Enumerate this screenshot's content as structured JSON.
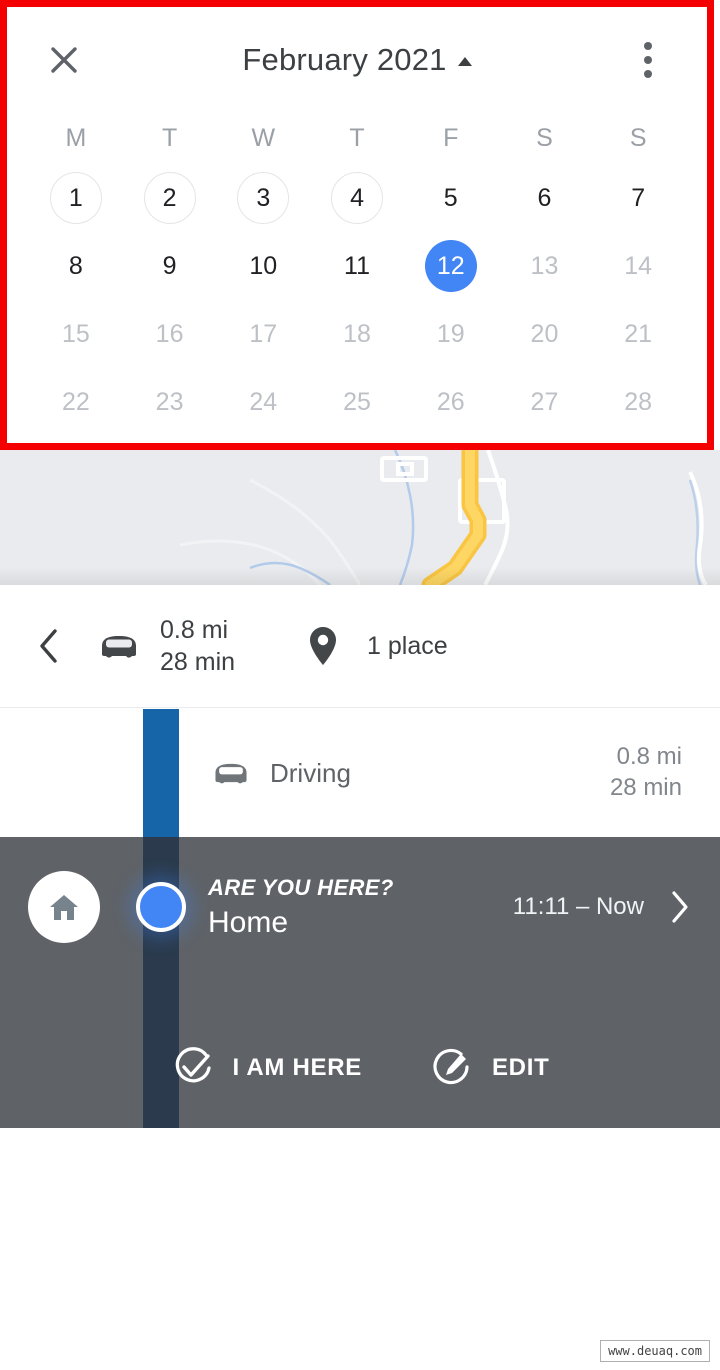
{
  "calendar": {
    "close_icon": "close-icon",
    "title": "February 2021",
    "expand_icon": "caret-up-icon",
    "menu_icon": "overflow-menu-icon",
    "weekdays": [
      "M",
      "T",
      "W",
      "T",
      "F",
      "S",
      "S"
    ],
    "weeks": [
      [
        {
          "day": "1",
          "state": "ring"
        },
        {
          "day": "2",
          "state": "ring"
        },
        {
          "day": "3",
          "state": "ring"
        },
        {
          "day": "4",
          "state": "ring"
        },
        {
          "day": "5",
          "state": "dark"
        },
        {
          "day": "6",
          "state": "dark"
        },
        {
          "day": "7",
          "state": "dark"
        }
      ],
      [
        {
          "day": "8",
          "state": "dark"
        },
        {
          "day": "9",
          "state": "dark"
        },
        {
          "day": "10",
          "state": "dark"
        },
        {
          "day": "11",
          "state": "dark"
        },
        {
          "day": "12",
          "state": "selected"
        },
        {
          "day": "13",
          "state": "dim"
        },
        {
          "day": "14",
          "state": "dim"
        }
      ],
      [
        {
          "day": "15",
          "state": "dim"
        },
        {
          "day": "16",
          "state": "dim"
        },
        {
          "day": "17",
          "state": "dim"
        },
        {
          "day": "18",
          "state": "dim"
        },
        {
          "day": "19",
          "state": "dim"
        },
        {
          "day": "20",
          "state": "dim"
        },
        {
          "day": "21",
          "state": "dim"
        }
      ],
      [
        {
          "day": "22",
          "state": "dim"
        },
        {
          "day": "23",
          "state": "dim"
        },
        {
          "day": "24",
          "state": "dim"
        },
        {
          "day": "25",
          "state": "dim"
        },
        {
          "day": "26",
          "state": "dim"
        },
        {
          "day": "27",
          "state": "dim"
        },
        {
          "day": "28",
          "state": "dim"
        }
      ]
    ],
    "selected_day": "12",
    "accent_color": "#4285f4",
    "highlight_border_color": "#f50000"
  },
  "summary": {
    "back_icon": "chevron-left-icon",
    "car_icon": "car-icon",
    "distance": "0.8 mi",
    "duration": "28 min",
    "place_icon": "map-pin-icon",
    "place_count": "1 place"
  },
  "driving": {
    "icon": "car-icon",
    "label": "Driving",
    "distance": "0.8 mi",
    "duration": "28 min",
    "timeline_color": "#1565a8"
  },
  "visit_panel": {
    "home_icon": "home-icon",
    "location_dot_icon": "location-dot-icon",
    "prompt": "ARE YOU HERE?",
    "place_name": "Home",
    "time_range": "11:11 – Now",
    "chevron_icon": "chevron-right-icon",
    "actions": [
      {
        "icon": "check-circle-icon",
        "label": "I AM HERE"
      },
      {
        "icon": "edit-circle-icon",
        "label": "EDIT"
      }
    ],
    "panel_color": "#5f6368"
  },
  "footer": {
    "watermark": "www.deuaq.com"
  }
}
